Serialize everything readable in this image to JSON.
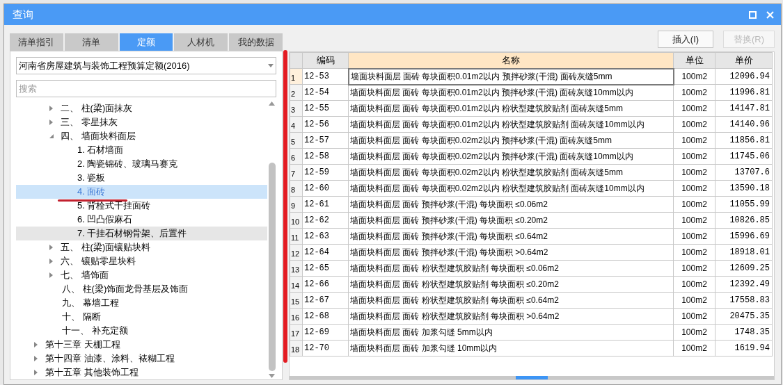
{
  "window": {
    "title": "查询"
  },
  "tabs": [
    {
      "label": "清单指引",
      "selected": false
    },
    {
      "label": "清单",
      "selected": false
    },
    {
      "label": "定额",
      "selected": true
    },
    {
      "label": "人材机",
      "selected": false
    },
    {
      "label": "我的数据",
      "selected": false
    }
  ],
  "library_select": {
    "value": "河南省房屋建筑与装饰工程预算定额(2016)"
  },
  "search": {
    "placeholder": "搜索"
  },
  "tree": [
    {
      "children": [
        {
          "label": "二、 柱(梁)面抹灰",
          "kind": "branch",
          "expanded": false,
          "selected": false,
          "hovered": false
        },
        {
          "label": "三、 零星抹灰",
          "kind": "branch",
          "expanded": false,
          "selected": false,
          "hovered": false
        },
        {
          "label": "四、 墙面块料面层",
          "kind": "branch",
          "expanded": true,
          "selected": false,
          "hovered": false,
          "children": [
            {
              "label": "1. 石材墙面",
              "kind": "leaf",
              "selected": false,
              "hovered": false
            },
            {
              "label": "2. 陶瓷锦砖、玻璃马赛克",
              "kind": "leaf",
              "selected": false,
              "hovered": false
            },
            {
              "label": "3. 瓷板",
              "kind": "leaf",
              "selected": false,
              "hovered": false
            },
            {
              "label": "4. 面砖",
              "kind": "leaf",
              "selected": true,
              "hovered": false
            },
            {
              "label": "5. 背栓式干挂面砖",
              "kind": "leaf",
              "selected": false,
              "hovered": false
            },
            {
              "label": "6. 凹凸假麻石",
              "kind": "leaf",
              "selected": false,
              "hovered": false
            },
            {
              "label": "7. 干挂石材钢骨架、后置件",
              "kind": "leaf",
              "selected": false,
              "hovered": true
            }
          ]
        },
        {
          "label": "五、 柱(梁)面镶贴块料",
          "kind": "branch",
          "expanded": false,
          "selected": false,
          "hovered": false
        },
        {
          "label": "六、 镶贴零星块料",
          "kind": "branch",
          "expanded": false,
          "selected": false,
          "hovered": false
        },
        {
          "label": "七、 墙饰面",
          "kind": "branch",
          "expanded": false,
          "selected": false,
          "hovered": false
        },
        {
          "label": "八、 柱(梁)饰面龙骨基层及饰面",
          "kind": "leaf",
          "selected": false,
          "hovered": false
        },
        {
          "label": "九、 幕墙工程",
          "kind": "leaf",
          "selected": false,
          "hovered": false
        },
        {
          "label": "十、 隔断",
          "kind": "leaf",
          "selected": false,
          "hovered": false
        },
        {
          "label": "十一、 补充定额",
          "kind": "leaf",
          "selected": false,
          "hovered": false
        }
      ]
    },
    {
      "label": "第十三章 天棚工程",
      "kind": "branch",
      "expanded": false,
      "selected": false,
      "hovered": false
    },
    {
      "label": "第十四章 油漆、涂料、裱糊工程",
      "kind": "branch",
      "expanded": false,
      "selected": false,
      "hovered": false
    },
    {
      "label": "第十五章 其他装饰工程",
      "kind": "branch",
      "expanded": false,
      "selected": false,
      "hovered": false
    }
  ],
  "buttons": [
    {
      "label": "插入(I)",
      "disabled": false
    },
    {
      "label": "替换(R)",
      "disabled": true
    }
  ],
  "table": {
    "columns": [
      {
        "label": "编码",
        "selected": false
      },
      {
        "label": "名称",
        "selected": true
      },
      {
        "label": "单位",
        "selected": false
      },
      {
        "label": "单价",
        "selected": false
      }
    ],
    "rows": [
      {
        "index": "1",
        "code": "12-53",
        "name": "墙面块料面层 面砖 每块面积0.01m2以内 预拌砂浆(干混) 面砖灰缝5mm",
        "unit": "100m2",
        "price": "12096.94",
        "selected": true
      },
      {
        "index": "2",
        "code": "12-54",
        "name": "墙面块料面层 面砖 每块面积0.01m2以内 预拌砂浆(干混) 面砖灰缝10mm以内",
        "unit": "100m2",
        "price": "11996.81",
        "selected": false
      },
      {
        "index": "3",
        "code": "12-55",
        "name": "墙面块料面层 面砖 每块面积0.01m2以内 粉状型建筑胶贴剂 面砖灰缝5mm",
        "unit": "100m2",
        "price": "14147.81",
        "selected": false
      },
      {
        "index": "4",
        "code": "12-56",
        "name": "墙面块料面层 面砖 每块面积0.01m2以内 粉状型建筑胶贴剂 面砖灰缝10mm以内",
        "unit": "100m2",
        "price": "14140.96",
        "selected": false
      },
      {
        "index": "5",
        "code": "12-57",
        "name": "墙面块料面层 面砖 每块面积0.02m2以内 预拌砂浆(干混) 面砖灰缝5mm",
        "unit": "100m2",
        "price": "11856.81",
        "selected": false
      },
      {
        "index": "6",
        "code": "12-58",
        "name": "墙面块料面层 面砖 每块面积0.02m2以内 预拌砂浆(干混) 面砖灰缝10mm以内",
        "unit": "100m2",
        "price": "11745.06",
        "selected": false
      },
      {
        "index": "7",
        "code": "12-59",
        "name": "墙面块料面层 面砖 每块面积0.02m2以内 粉状型建筑胶贴剂 面砖灰缝5mm",
        "unit": "100m2",
        "price": "13707.6",
        "selected": false
      },
      {
        "index": "8",
        "code": "12-60",
        "name": "墙面块料面层 面砖 每块面积0.02m2以内 粉状型建筑胶贴剂 面砖灰缝10mm以内",
        "unit": "100m2",
        "price": "13590.18",
        "selected": false
      },
      {
        "index": "9",
        "code": "12-61",
        "name": "墙面块料面层 面砖 预拌砂浆(干混) 每块面积 ≤0.06m2",
        "unit": "100m2",
        "price": "11055.99",
        "selected": false
      },
      {
        "index": "10",
        "code": "12-62",
        "name": "墙面块料面层 面砖 预拌砂浆(干混) 每块面积 ≤0.20m2",
        "unit": "100m2",
        "price": "10826.85",
        "selected": false
      },
      {
        "index": "11",
        "code": "12-63",
        "name": "墙面块料面层 面砖 预拌砂浆(干混) 每块面积 ≤0.64m2",
        "unit": "100m2",
        "price": "15996.69",
        "selected": false
      },
      {
        "index": "12",
        "code": "12-64",
        "name": "墙面块料面层 面砖 预拌砂浆(干混) 每块面积 >0.64m2",
        "unit": "100m2",
        "price": "18918.01",
        "selected": false
      },
      {
        "index": "13",
        "code": "12-65",
        "name": "墙面块料面层 面砖 粉状型建筑胶贴剂 每块面积 ≤0.06m2",
        "unit": "100m2",
        "price": "12609.25",
        "selected": false
      },
      {
        "index": "14",
        "code": "12-66",
        "name": "墙面块料面层 面砖 粉状型建筑胶贴剂 每块面积 ≤0.20m2",
        "unit": "100m2",
        "price": "12392.49",
        "selected": false
      },
      {
        "index": "15",
        "code": "12-67",
        "name": "墙面块料面层 面砖 粉状型建筑胶贴剂 每块面积 ≤0.64m2",
        "unit": "100m2",
        "price": "17558.83",
        "selected": false
      },
      {
        "index": "16",
        "code": "12-68",
        "name": "墙面块料面层 面砖 粉状型建筑胶贴剂 每块面积 >0.64m2",
        "unit": "100m2",
        "price": "20475.35",
        "selected": false
      },
      {
        "index": "17",
        "code": "12-69",
        "name": "墙面块料面层 面砖 加浆勾缝 5mm以内",
        "unit": "100m2",
        "price": "1748.35",
        "selected": false
      },
      {
        "index": "18",
        "code": "12-70",
        "name": "墙面块料面层 面砖 加浆勾缝 10mm以内",
        "unit": "100m2",
        "price": "1619.94",
        "selected": false
      }
    ]
  },
  "markup": {
    "table_stroke": true,
    "tree_underline": true
  }
}
